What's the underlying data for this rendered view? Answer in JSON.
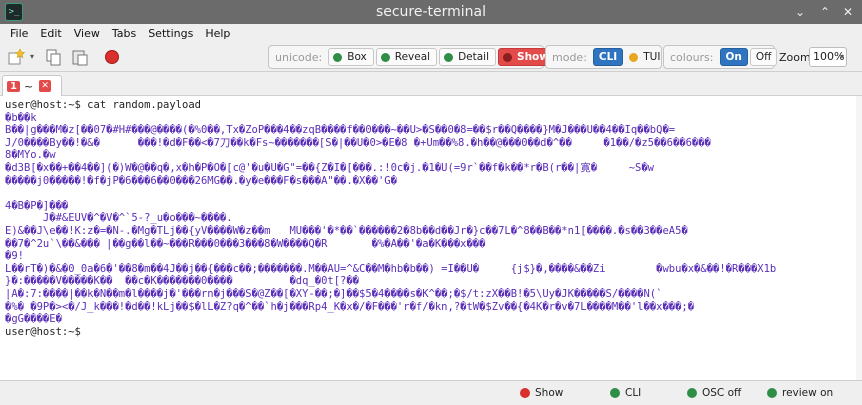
{
  "window": {
    "title": "secure-terminal"
  },
  "menu": [
    "File",
    "Edit",
    "View",
    "Tabs",
    "Settings",
    "Help"
  ],
  "toolbar": {
    "unicode_label": "unicode:",
    "unicode_box": "Box",
    "unicode_reveal": "Reveal",
    "unicode_detail": "Detail",
    "unicode_show": "Show",
    "mode_label": "mode:",
    "mode_cli": "CLI",
    "mode_tui": "TUI",
    "colours_label": "colours:",
    "colours_on": "On",
    "colours_off": "Off",
    "zoom_label": "Zoom",
    "zoom_value": "100%"
  },
  "tab": {
    "number": "1",
    "label": "~"
  },
  "terminal": {
    "lines": [
      "user@host:~$ cat random.payload",
      "�b��k",
      "B��|g���M�z[��07�#H#���@����(�%0��,Tx�ZoP���4��zqB����f��0���~��U>�S��0�8=��$r��Q����}M�J���U��4��Iq��bQ�=",
      "J/0����By��!�&�      ���!�d�F��<�7刀��k�Fs~�������[S�|��U�0>�E�8 �+Um��%8.�h��@���0��d�^��     �1��/�z5��6��6���",
      "8�MYo.�w",
      "�d3B[�x��+��4��](�)W�@��q�,x�h�P�O�[c@'�u�U�G\"=��{Z�I�[���.:!0c�j.�1�U(=9r`��f�k��*r�B(r��|寛�     ~S�w",
      "�����j0�����!�f�jP�6���6��0���26MG��.�y�e���F�s���A\"��.�X��'G�",
      "",
      "4�B�P�]���",
      "      J�#&EUV�^�V�^`5-?_u�o���~����.",
      "E)&��J\\e��!K:z�=�N-.�Mg�TLj��{yV����W�z��m   MU���'�*��`������2�8b��d��Jr�}c��7L�^8��B��*n1[����.�s��3��eA5�",
      "��7�^2u`\\��&��� |��g��l��~���R���0���3���8�W����Q�R       �%�A��'�a�K���x���",
      "�9!",
      "L��rT�)�&�0_0a�6�'��8�m��4J��j��{���c��;�������.M��AU=^&C��M�hb�b��) =I��U�     {j$}�,����&��Zi        �wbu�x�&��!�R���X1b",
      "}�:�����V�����K��  ��c�K�������0����         �dq_�0t[?��",
      "|A�:7:����|��k�N��m�l����j�'���rn�j���S�@Z��[�XY-��;�]��$5�4����s�K^��;�$/t:zX��B!�5\\Uy�JK�����S/����N(`",
      "�%� �9P�><�/J_k���!�d��!kLj��$�lL�Z?q�^��`h�j���Rp4_K�x�/�F���'r�f/�kn,?�tW�$Zv��{�4K�r�v�7L����M��'l��x���;�",
      "�gG����E�",
      "user@host:~$ "
    ]
  },
  "status": {
    "show": "Show",
    "cli": "CLI",
    "osc": "OSC off",
    "review": "review on"
  }
}
